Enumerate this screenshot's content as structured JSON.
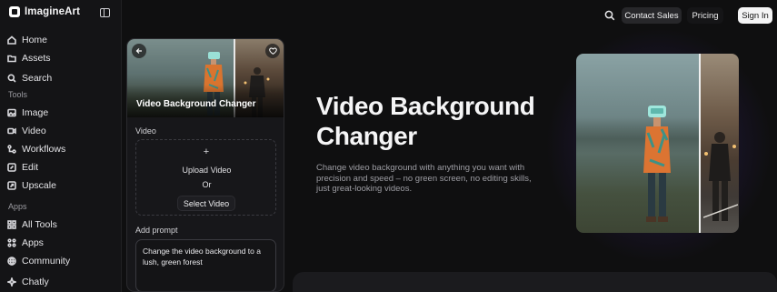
{
  "brand": {
    "name": "ImagineArt"
  },
  "sidebar": {
    "top_items": [
      {
        "label": "Home",
        "icon": "home-icon"
      },
      {
        "label": "Assets",
        "icon": "folder-icon"
      },
      {
        "label": "Search",
        "icon": "search-icon"
      }
    ],
    "tools_label": "Tools",
    "tools": [
      {
        "label": "Image",
        "icon": "image-icon"
      },
      {
        "label": "Video",
        "icon": "video-icon"
      },
      {
        "label": "Workflows",
        "icon": "workflow-icon"
      },
      {
        "label": "Edit",
        "icon": "edit-icon"
      },
      {
        "label": "Upscale",
        "icon": "upscale-icon"
      }
    ],
    "apps_label": "Apps",
    "apps": [
      {
        "label": "All Tools",
        "icon": "grid-icon"
      },
      {
        "label": "Apps",
        "icon": "apps-icon"
      },
      {
        "label": "Community",
        "icon": "globe-icon"
      },
      {
        "label": "Chatly",
        "icon": "chat-icon"
      }
    ]
  },
  "header": {
    "contact_label": "Contact Sales",
    "pricing_label": "Pricing",
    "signin_label": "Sign In"
  },
  "panel": {
    "title": "Video Background Changer",
    "video_label": "Video",
    "upload_label": "Upload Video",
    "or_label": "Or",
    "select_label": "Select Video",
    "prompt_label": "Add prompt",
    "prompt_value": "Change the video background to a lush, green forest"
  },
  "hero": {
    "title": "Video Background Changer",
    "description": "Change video background with anything you want with precision and speed – no green screen, no editing skills, just great-looking videos."
  },
  "colors": {
    "accent_glow": "#5834b4",
    "signin_bg": "#f4f4f5"
  }
}
